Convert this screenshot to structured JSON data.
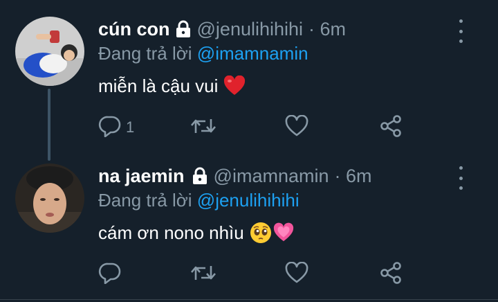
{
  "tweets": [
    {
      "display_name": "cún con",
      "handle": "@jenulihihihi",
      "time": "· 6m",
      "replying_prefix": "Đang trả lời",
      "replying_to": "@imamnamin",
      "text": "miễn là cậu vui",
      "text_emoji": "red-heart",
      "reply_count": "1",
      "protected": true
    },
    {
      "display_name": "na jaemin",
      "handle": "@imamnamin",
      "time": "· 6m",
      "replying_prefix": "Đang trả lời",
      "replying_to": "@jenulihihihi",
      "text": "cám ơn nono nhìu",
      "text_emoji": [
        "pleading-face",
        "growing-heart"
      ],
      "reply_count": "",
      "protected": true
    }
  ],
  "colors": {
    "background": "#15202b",
    "secondary_text": "#8899a6",
    "accent": "#1da1f2",
    "thread_line": "#3d5466"
  },
  "icons": [
    "lock-icon",
    "reply-icon",
    "retweet-icon",
    "like-icon",
    "share-icon",
    "more-icon"
  ]
}
